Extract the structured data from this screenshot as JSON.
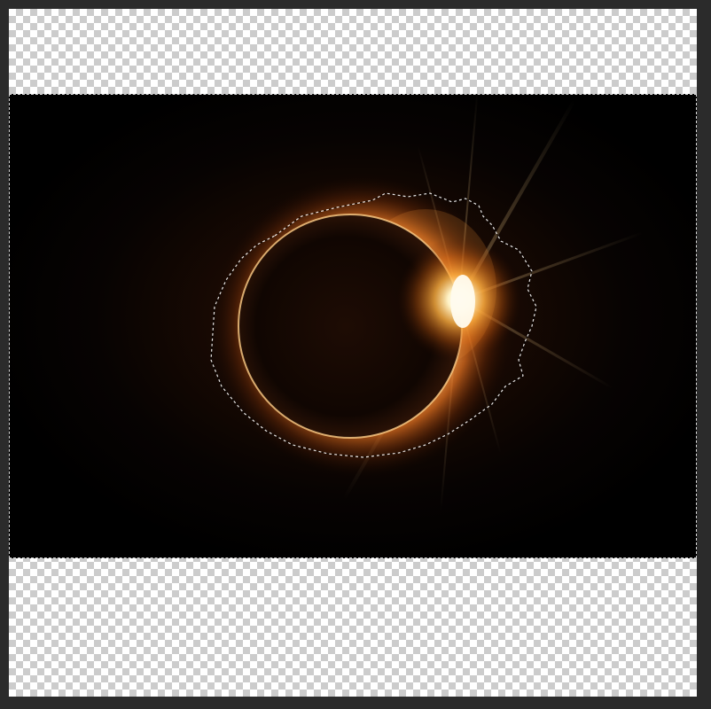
{
  "canvas": {
    "transparency_pattern": "checkerboard",
    "checker_colors": [
      "#ffffff",
      "#cccccc"
    ],
    "workspace_color": "#2b2b2b"
  },
  "layer": {
    "content": "solar-eclipse-photo",
    "selection": "marching-ants-around-corona"
  },
  "colors": {
    "corona_glow": "#ff9a3a",
    "flare_core": "#fff6d8",
    "moon_disk": "#0a0402",
    "background": "#000000"
  }
}
